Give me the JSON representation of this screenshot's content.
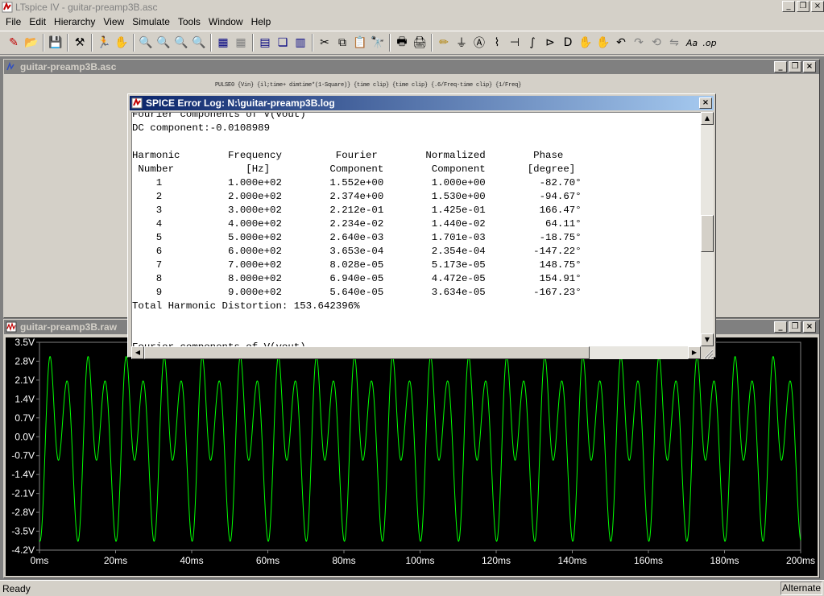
{
  "app": {
    "title": "LTspice IV - guitar-preamp3B.asc",
    "min_glyph": "_",
    "restore_glyph": "❐",
    "close_glyph": "×"
  },
  "menu": [
    "File",
    "Edit",
    "Hierarchy",
    "View",
    "Simulate",
    "Tools",
    "Window",
    "Help"
  ],
  "toolbar": {
    "groups": [
      [
        {
          "name": "new-schematic-icon",
          "glyph": "✎",
          "color": "#c00000"
        },
        {
          "name": "open-file-icon",
          "glyph": "📂",
          "color": "#b08000"
        }
      ],
      [
        {
          "name": "save-icon",
          "glyph": "💾",
          "color": "#000080"
        }
      ],
      [
        {
          "name": "control-panel-icon",
          "glyph": "⚒",
          "color": "#000"
        }
      ],
      [
        {
          "name": "run-icon",
          "glyph": "🏃",
          "color": "#000"
        },
        {
          "name": "halt-icon",
          "glyph": "✋",
          "color": "#808080"
        }
      ],
      [
        {
          "name": "zoom-area-icon",
          "glyph": "🔍",
          "color": "#000"
        },
        {
          "name": "pan-icon",
          "glyph": "🔍",
          "color": "#808080"
        },
        {
          "name": "zoom-back-icon",
          "glyph": "🔍",
          "color": "#000"
        },
        {
          "name": "zoom-fit-icon",
          "glyph": "🔍",
          "color": "#c00000"
        }
      ],
      [
        {
          "name": "autorange-icon",
          "glyph": "▦",
          "color": "#000080"
        },
        {
          "name": "grid-icon",
          "glyph": "▦",
          "color": "#808080"
        }
      ],
      [
        {
          "name": "tile-horizontal-icon",
          "glyph": "▤",
          "color": "#000080"
        },
        {
          "name": "cascade-icon",
          "glyph": "❏",
          "color": "#000080"
        },
        {
          "name": "tile-vertical-icon",
          "glyph": "▥",
          "color": "#000080"
        }
      ],
      [
        {
          "name": "cut-icon",
          "glyph": "✂",
          "color": "#000"
        },
        {
          "name": "copy-icon",
          "glyph": "⧉",
          "color": "#000"
        },
        {
          "name": "paste-icon",
          "glyph": "📋",
          "color": "#000"
        },
        {
          "name": "find-icon",
          "glyph": "🔭",
          "color": "#000"
        }
      ],
      [
        {
          "name": "print-setup-icon",
          "glyph": "🖶",
          "color": "#000"
        },
        {
          "name": "print-icon",
          "glyph": "🖨",
          "color": "#000"
        }
      ],
      [
        {
          "name": "draw-wire-icon",
          "glyph": "✏",
          "color": "#b08000"
        },
        {
          "name": "ground-icon",
          "glyph": "⏚",
          "color": "#000"
        },
        {
          "name": "label-net-icon",
          "glyph": "Ⓐ",
          "color": "#000"
        },
        {
          "name": "resistor-icon",
          "glyph": "⌇",
          "color": "#000"
        },
        {
          "name": "capacitor-icon",
          "glyph": "⊣",
          "color": "#000"
        },
        {
          "name": "inductor-icon",
          "glyph": "∫",
          "color": "#000"
        },
        {
          "name": "diode-icon",
          "glyph": "⊳",
          "color": "#000"
        },
        {
          "name": "component-icon",
          "glyph": "D",
          "color": "#000"
        },
        {
          "name": "move-icon",
          "glyph": "✋",
          "color": "#000"
        },
        {
          "name": "drag-icon",
          "glyph": "✋",
          "color": "#000"
        },
        {
          "name": "undo-icon",
          "glyph": "↶",
          "color": "#000"
        },
        {
          "name": "redo-icon",
          "glyph": "↷",
          "color": "#808080"
        },
        {
          "name": "rotate-icon",
          "glyph": "⟲",
          "color": "#808080"
        },
        {
          "name": "mirror-icon",
          "glyph": "⇋",
          "color": "#808080"
        },
        {
          "name": "text-icon",
          "glyph": "Aa",
          "color": "#000"
        },
        {
          "name": "spice-directive-icon",
          "glyph": ".op",
          "color": "#000"
        }
      ]
    ]
  },
  "schematic_window": {
    "title": "guitar-preamp3B.asc",
    "pulse_directive": "PULSE0 {Vin} {il;time+ dimtime*(1-Square)} {time clip} {time clip} {.6/Freq-time clip} {1/Freq}"
  },
  "log_dialog": {
    "title": "SPICE Error Log: N:\\guitar-preamp3B.log",
    "text": "Fourier components of V(vout)\nDC component:-0.0108989\n\nHarmonic        Frequency         Fourier        Normalized        Phase\n Number            [Hz]          Component        Component       [degree]\n    1           1.000e+02        1.552e+00        1.000e+00         -82.70°\n    2           2.000e+02        2.374e+00        1.530e+00         -94.67°\n    3           3.000e+02        2.212e-01        1.425e-01         166.47°\n    4           4.000e+02        2.234e-02        1.440e-02          64.11°\n    5           5.000e+02        2.640e-03        1.701e-03         -18.75°\n    6           6.000e+02        3.653e-04        2.354e-04        -147.22°\n    7           7.000e+02        8.028e-05        5.173e-05         148.75°\n    8           8.000e+02        6.940e-05        4.472e-05         154.91°\n    9           9.000e+02        5.640e-05        3.634e-05        -167.23°\nTotal Harmonic Distortion: 153.642396%\n\n\nFourier components of V(vout)",
    "scroll_up": "▲",
    "scroll_down": "▼",
    "scroll_left": "◀",
    "scroll_right": "▶"
  },
  "plot_window": {
    "title": "guitar-preamp3B.raw",
    "trace_color": "#00ff00",
    "frame_color": "#808080",
    "label_color": "#ffffff"
  },
  "chart_data": {
    "type": "line",
    "title": "",
    "xlabel": "",
    "ylabel": "",
    "x_ticks": [
      "0ms",
      "20ms",
      "40ms",
      "60ms",
      "80ms",
      "100ms",
      "120ms",
      "140ms",
      "160ms",
      "180ms",
      "200ms"
    ],
    "y_ticks": [
      "3.5V",
      "2.8V",
      "2.1V",
      "1.4V",
      "0.7V",
      "0.0V",
      "-0.7V",
      "-1.4V",
      "-2.1V",
      "-2.8V",
      "-3.5V",
      "-4.2V"
    ],
    "xlim": [
      0,
      200
    ],
    "ylim": [
      -4.2,
      3.5
    ],
    "grid": false,
    "series": [
      {
        "frequency_hz": 100,
        "dc_offset": -0.0108989,
        "harmonics": [
          {
            "n": 1,
            "amplitude": 1.552,
            "phase_deg": -82.7
          },
          {
            "n": 2,
            "amplitude": 2.374,
            "phase_deg": -94.67
          },
          {
            "n": 3,
            "amplitude": 0.2212,
            "phase_deg": 166.47
          },
          {
            "n": 4,
            "amplitude": 0.02234,
            "phase_deg": 64.11
          }
        ]
      }
    ]
  },
  "status": {
    "left": "Ready",
    "right": "Alternate"
  }
}
